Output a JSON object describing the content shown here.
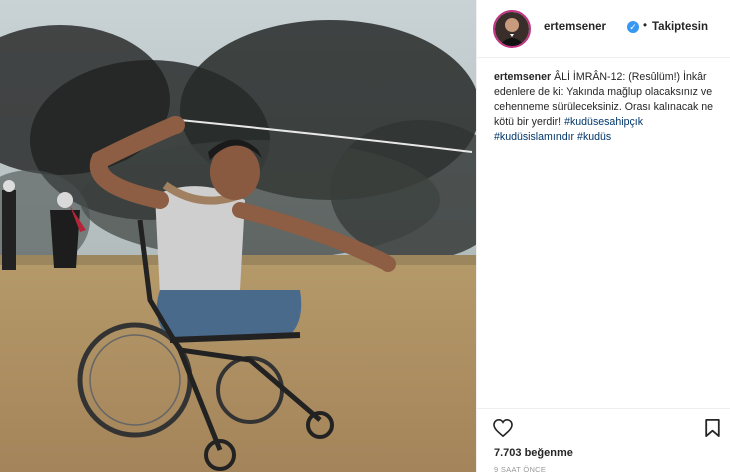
{
  "post": {
    "username": "ertemsener",
    "follow_status": "Takiptesin",
    "caption": {
      "username": "ertemsener",
      "text": "ÂLİ İMRÂN-12: (Resûlüm!) İnkâr edenlere de ki: Yakında mağlup olacaksınız ve cehenneme sürüleceksiniz. Orası kalınacak ne kötü bir yerdir!",
      "hashtags": [
        "#kudüsesahipçık",
        "#kudüsislamındır",
        "#kudüs"
      ]
    },
    "likes": "7.703 beğenme",
    "timestamp": "9 SAAT ÖNCE"
  },
  "icons": {
    "like": "heart-icon",
    "save": "bookmark-icon",
    "verified": "verified-badge-icon"
  },
  "colors": {
    "verified": "#3897f0",
    "hashtag": "#003569",
    "text": "#262626",
    "muted": "#999999"
  }
}
